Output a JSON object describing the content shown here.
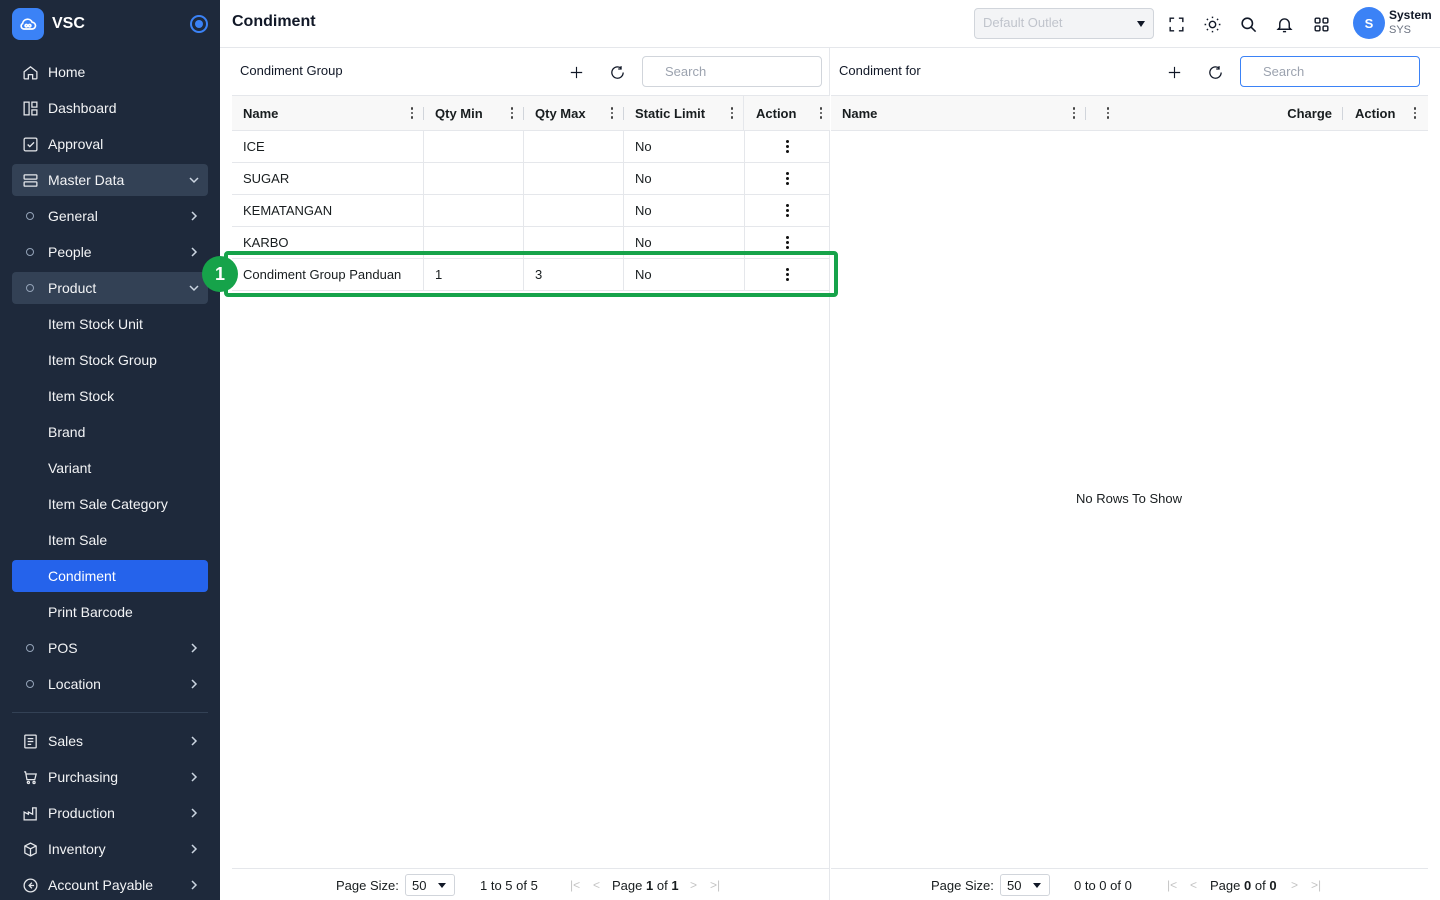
{
  "brand": {
    "name": "VSC"
  },
  "sidebar": {
    "items": [
      {
        "label": "Home",
        "icon": "home-icon"
      },
      {
        "label": "Dashboard",
        "icon": "dashboard-icon"
      },
      {
        "label": "Approval",
        "icon": "approval-icon"
      },
      {
        "label": "Master Data",
        "icon": "master-data-icon"
      },
      {
        "label": "General"
      },
      {
        "label": "People"
      },
      {
        "label": "Product"
      },
      {
        "label": "Item Stock Unit"
      },
      {
        "label": "Item Stock Group"
      },
      {
        "label": "Item Stock"
      },
      {
        "label": "Brand"
      },
      {
        "label": "Variant"
      },
      {
        "label": "Item Sale Category"
      },
      {
        "label": "Item Sale"
      },
      {
        "label": "Condiment"
      },
      {
        "label": "Print Barcode"
      },
      {
        "label": "POS"
      },
      {
        "label": "Location"
      },
      {
        "label": "Sales",
        "icon": "sales-icon"
      },
      {
        "label": "Purchasing",
        "icon": "cart-icon"
      },
      {
        "label": "Production",
        "icon": "factory-icon"
      },
      {
        "label": "Inventory",
        "icon": "box-icon"
      },
      {
        "label": "Account Payable",
        "icon": "payable-icon"
      }
    ]
  },
  "header": {
    "title": "Condiment",
    "outlet_placeholder": "Default Outlet",
    "user": {
      "initial": "S",
      "name": "System",
      "code": "SYS"
    }
  },
  "left_panel": {
    "title": "Condiment Group",
    "search_placeholder": "Search",
    "columns": [
      "Name",
      "Qty Min",
      "Qty Max",
      "Static Limit",
      "Action"
    ],
    "rows": [
      {
        "name": "ICE",
        "qty_min": "",
        "qty_max": "",
        "static_limit": "No"
      },
      {
        "name": "SUGAR",
        "qty_min": "",
        "qty_max": "",
        "static_limit": "No"
      },
      {
        "name": "KEMATANGAN",
        "qty_min": "",
        "qty_max": "",
        "static_limit": "No"
      },
      {
        "name": "KARBO",
        "qty_min": "",
        "qty_max": "",
        "static_limit": "No"
      },
      {
        "name": "Condiment Group Panduan",
        "qty_min": "1",
        "qty_max": "3",
        "static_limit": "No"
      }
    ],
    "footer": {
      "page_size_label": "Page Size:",
      "page_size": "50",
      "range": "1 to 5 of 5",
      "page_label": "Page",
      "page": "1",
      "of_label": "of",
      "total_pages": "1"
    }
  },
  "right_panel": {
    "title": "Condiment for",
    "search_placeholder": "Search",
    "columns": [
      "Name",
      "",
      "Charge",
      "Action"
    ],
    "empty_message": "No Rows To Show",
    "footer": {
      "page_size_label": "Page Size:",
      "page_size": "50",
      "range": "0 to 0 of 0",
      "page_label": "Page",
      "page": "0",
      "of_label": "of",
      "total_pages": "0"
    }
  },
  "annotation": {
    "number": "1",
    "color": "#16a34a"
  },
  "colors": {
    "sidebar_bg": "#1e293b",
    "accent": "#2563eb"
  }
}
